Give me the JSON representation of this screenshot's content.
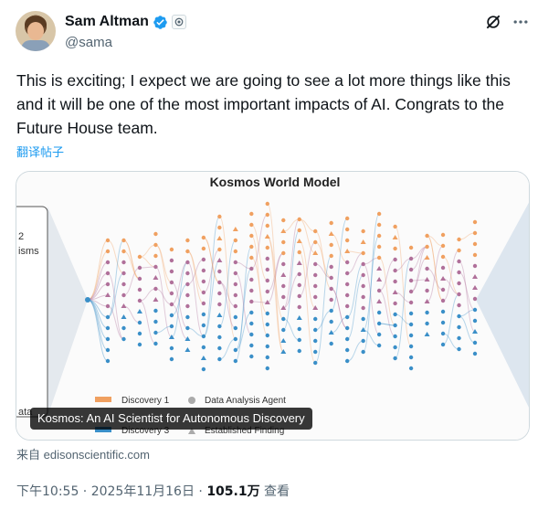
{
  "author": {
    "name": "Sam Altman",
    "handle": "@sama"
  },
  "tweet": {
    "text": "This is exciting; I expect we are going to see a lot more things like this and it will be one of the most important impacts of AI. Congrats to the Future House team.",
    "translate_label": "翻译帖子"
  },
  "card": {
    "image_title": "Kosmos World Model",
    "left_text_top": "2",
    "left_text_mid": "isms",
    "left_text_bottom": "ata",
    "legend": {
      "discovery1": "Discovery 1",
      "discovery3": "Discovery 3",
      "agent": "Data Analysis Agent",
      "finding": "Established Finding"
    },
    "caption": "Kosmos: An AI Scientist for Autonomous Discovery",
    "source": "来自 edisonscientific.com"
  },
  "meta": {
    "time": "下午10:55 · 2025年11月16日 · ",
    "views": "105.1万",
    "views_label": " 查看"
  },
  "colors": {
    "accent": "#1d9bf0",
    "orange": "#f0a060",
    "purple": "#b0709a",
    "blue": "#3a8fc8"
  }
}
